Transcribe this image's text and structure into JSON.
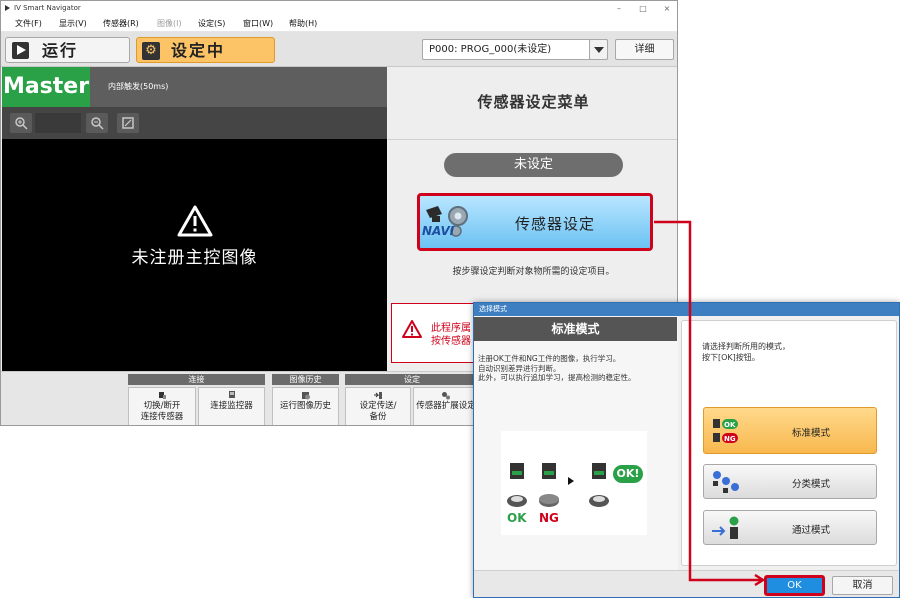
{
  "window": {
    "title": "IV Smart Navigator",
    "controls": [
      "–",
      "□",
      "×"
    ]
  },
  "menu": {
    "items": [
      {
        "label": "文件(F)",
        "enabled": true
      },
      {
        "label": "显示(V)",
        "enabled": true
      },
      {
        "label": "传感器(R)",
        "enabled": true
      },
      {
        "label": "图像(I)",
        "enabled": false
      },
      {
        "label": "设定(S)",
        "enabled": true
      },
      {
        "label": "窗口(W)",
        "enabled": true
      },
      {
        "label": "帮助(H)",
        "enabled": true
      }
    ]
  },
  "toolbar": {
    "run_label": "运行",
    "setting_label": "设定中",
    "program": "P000: PROG_000(未设定)",
    "detail_label": "详细"
  },
  "image_panel": {
    "master_label": "Master",
    "trigger_label": "内部触发(50ms)",
    "no_image_text": "未注册主控图像"
  },
  "settings_menu": {
    "title": "传感器设定菜单",
    "status": "未设定",
    "sensor_setting_label": "传感器设定",
    "navi_label": "NAVI",
    "description": "按步骤设定判断对象物所需的设定项目。",
    "warning_line1": "此程序属",
    "warning_line2": "按传感器"
  },
  "bottom_bar": {
    "groups": [
      {
        "label": "连接"
      },
      {
        "label": "图像历史"
      },
      {
        "label": "设定"
      }
    ],
    "buttons": [
      {
        "line1": "切换/断开",
        "line2": "连接传感器"
      },
      {
        "line1": "连接监控器",
        "line2": ""
      },
      {
        "line1": "运行图像历史",
        "line2": ""
      },
      {
        "line1": "设定传送/",
        "line2": "备份"
      },
      {
        "line1": "传感器扩展设定",
        "line2": ""
      }
    ]
  },
  "dialog": {
    "title": "选择模式",
    "mode_title": "标准模式",
    "description": [
      "注册OK工件和NG工件的图像，执行学习。",
      "自动识别差异进行判断。",
      "此外，可以执行追加学习，提高检测的稳定性。"
    ],
    "illustration": {
      "ok": "OK",
      "ng": "NG",
      "result": "OK!"
    },
    "instruction": [
      "请选择判断所用的模式，",
      "按下[OK]按钮。"
    ],
    "options": [
      {
        "label": "标准模式",
        "selected": true
      },
      {
        "label": "分类模式",
        "selected": false
      },
      {
        "label": "通过模式",
        "selected": false
      }
    ],
    "ok_label": "OK",
    "cancel_label": "取消"
  },
  "colors": {
    "accent_orange": "#fcc466",
    "master_green": "#2aa047",
    "highlight_red": "#d0021b",
    "button_blue": "#1f8de0"
  }
}
